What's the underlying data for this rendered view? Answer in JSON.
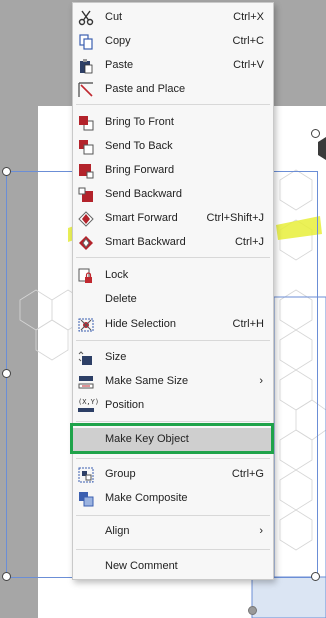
{
  "menu": {
    "items": [
      {
        "label": "Cut",
        "shortcut": "Ctrl+X",
        "icon": "scissors-icon"
      },
      {
        "label": "Copy",
        "shortcut": "Ctrl+C",
        "icon": "copy-icon"
      },
      {
        "label": "Paste",
        "shortcut": "Ctrl+V",
        "icon": "paste-icon"
      },
      {
        "label": "Paste and Place",
        "shortcut": "",
        "icon": "paste-place-icon"
      },
      {
        "label": "Bring To Front",
        "shortcut": "",
        "icon": "bring-to-front-icon"
      },
      {
        "label": "Send To Back",
        "shortcut": "",
        "icon": "send-to-back-icon"
      },
      {
        "label": "Bring Forward",
        "shortcut": "",
        "icon": "bring-forward-icon"
      },
      {
        "label": "Send Backward",
        "shortcut": "",
        "icon": "send-backward-icon"
      },
      {
        "label": "Smart Forward",
        "shortcut": "Ctrl+Shift+J",
        "icon": "smart-forward-icon"
      },
      {
        "label": "Smart Backward",
        "shortcut": "Ctrl+J",
        "icon": "smart-backward-icon"
      },
      {
        "label": "Lock",
        "shortcut": "",
        "icon": "lock-icon"
      },
      {
        "label": "Delete",
        "shortcut": "",
        "icon": ""
      },
      {
        "label": "Hide Selection",
        "shortcut": "Ctrl+H",
        "icon": "hide-selection-icon"
      },
      {
        "label": "Size",
        "shortcut": "",
        "icon": "size-icon"
      },
      {
        "label": "Make Same Size",
        "shortcut": "",
        "icon": "make-same-size-icon"
      },
      {
        "label": "Position",
        "shortcut": "",
        "icon": "position-xy-icon",
        "icon_text": "(X,Y)"
      },
      {
        "label": "Make Key Object",
        "shortcut": "",
        "icon": ""
      },
      {
        "label": "Group",
        "shortcut": "Ctrl+G",
        "icon": "group-icon"
      },
      {
        "label": "Make Composite",
        "shortcut": "",
        "icon": "make-composite-icon"
      },
      {
        "label": "Align",
        "shortcut": "",
        "icon": ""
      },
      {
        "label": "New Comment",
        "shortcut": "",
        "icon": ""
      }
    ],
    "submenu_arrow": "›"
  },
  "colors": {
    "accent_green": "#1fa34a",
    "selection_blue": "#6b8ed6",
    "menu_bg": "#f7f7f7",
    "highlight_yellow": "#e8ee3a"
  }
}
